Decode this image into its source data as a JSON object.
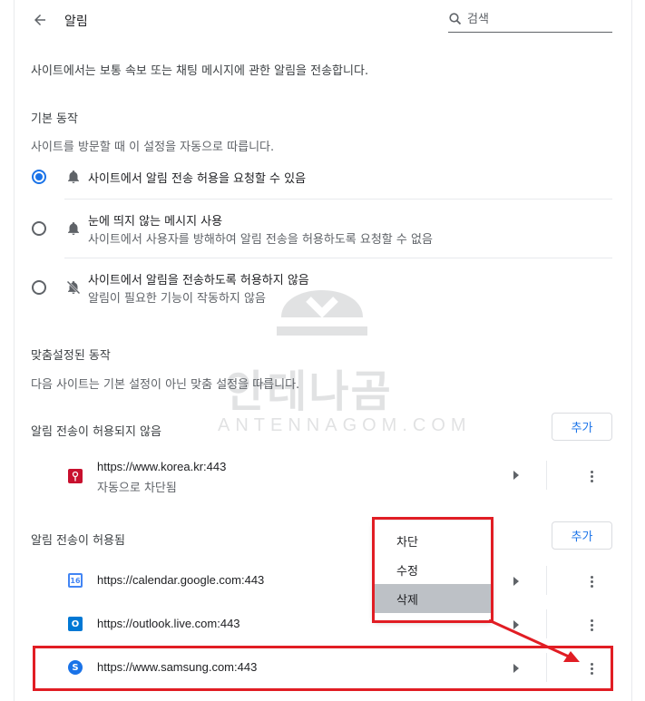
{
  "header": {
    "title": "알림",
    "search_placeholder": "검색"
  },
  "description": "사이트에서는 보통 속보 또는 채팅 메시지에 관한 알림을 전송합니다.",
  "default_behavior": {
    "title": "기본 동작",
    "subtitle": "사이트를 방문할 때 이 설정을 자동으로 따릅니다.",
    "options": [
      {
        "label": "사이트에서 알림 전송 허용을 요청할 수 있음",
        "sub": "",
        "checked": true,
        "icon": "bell-icon"
      },
      {
        "label": "눈에 띄지 않는 메시지 사용",
        "sub": "사이트에서 사용자를 방해하여 알림 전송을 허용하도록 요청할 수 없음",
        "checked": false,
        "icon": "bell-icon"
      },
      {
        "label": "사이트에서 알림을 전송하도록 허용하지 않음",
        "sub": "알림이 필요한 기능이 작동하지 않음",
        "checked": false,
        "icon": "bell-off-icon"
      }
    ]
  },
  "custom_behavior": {
    "title": "맞춤설정된 동작",
    "subtitle": "다음 사이트는 기본 설정이 아닌 맞춤 설정을 따릅니다."
  },
  "blocked": {
    "title": "알림 전송이 허용되지 않음",
    "add_label": "추가",
    "sites": [
      {
        "url": "https://www.korea.kr:443",
        "sub": "자동으로 차단됨",
        "icon": "korea-favicon",
        "color": "#c8102e"
      }
    ]
  },
  "allowed": {
    "title": "알림 전송이 허용됨",
    "add_label": "추가",
    "sites": [
      {
        "url": "https://calendar.google.com:443",
        "icon": "google-calendar-favicon",
        "color": "#4285f4",
        "badge": "16"
      },
      {
        "url": "https://outlook.live.com:443",
        "icon": "outlook-favicon",
        "color": "#0078d4",
        "badge": "O"
      },
      {
        "url": "https://www.samsung.com:443",
        "icon": "samsung-favicon",
        "color": "#1a73e8",
        "badge": "S"
      }
    ]
  },
  "context_menu": {
    "items": [
      "차단",
      "수정",
      "삭제"
    ],
    "highlighted": "삭제"
  },
  "watermark": {
    "korean": "안테나곰",
    "latin": "ANTENNAGOM.COM"
  },
  "colors": {
    "accent": "#1a73e8",
    "annotation_red": "#e11d24"
  }
}
